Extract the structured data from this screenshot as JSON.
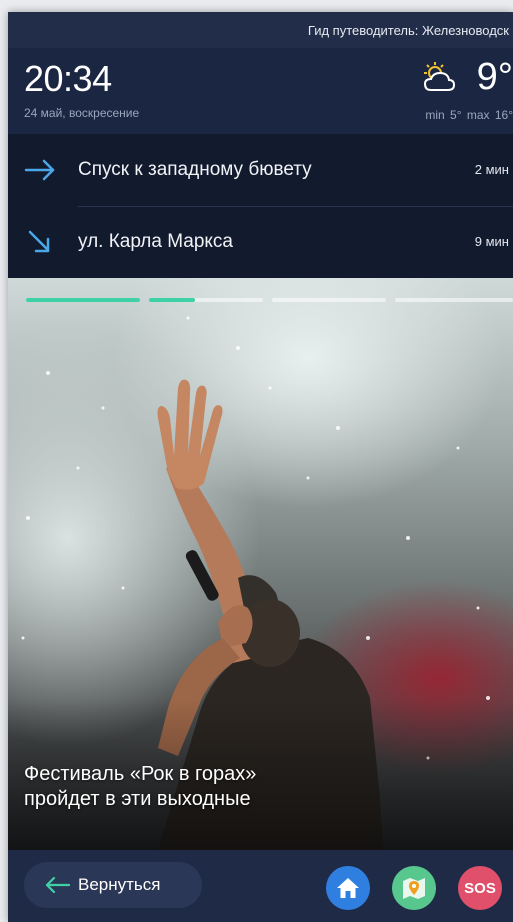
{
  "topbar": {
    "title": "Гид путеводитель: Железноводск"
  },
  "header": {
    "time": "20:34",
    "date": "24 май, воскресение",
    "weather": {
      "icon": "partly-cloudy-icon",
      "temperature": "9°",
      "minmax": "min 5°  max 16°"
    }
  },
  "navigation": {
    "items": [
      {
        "icon": "arrow-right-icon",
        "destination": "Спуск к западному бювету",
        "eta": "2 мин"
      },
      {
        "icon": "arrow-down-right-icon",
        "destination": "ул. Карла Маркса",
        "eta": "9 мин"
      }
    ]
  },
  "story": {
    "progress": [
      1.0,
      0.4,
      0,
      0
    ],
    "caption_line1": "Фестиваль «Рок в горах»",
    "caption_line2": "пройдет в эти выходные"
  },
  "bottombar": {
    "back_label": "Вернуться",
    "home_icon": "home-icon",
    "map_icon": "map-pin-icon",
    "sos_label": "SOS"
  },
  "colors": {
    "accent": "#3fd1a6",
    "nav_arrow": "#4aa8e8",
    "background": "#18213a",
    "home": "#2f7fe0",
    "map": "#58c78e",
    "sos": "#e0506a"
  }
}
